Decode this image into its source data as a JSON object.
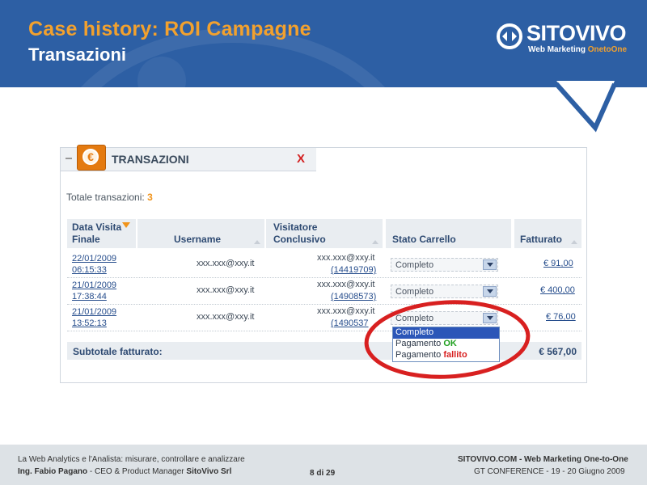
{
  "header": {
    "title": "Case history: ROI Campagne",
    "subtitle": "Transazioni",
    "logo_name": "SITOVIVO",
    "logo_tagline_main": "Web Marketing ",
    "logo_tagline_accent": "OnetoOne"
  },
  "panel": {
    "title": "TRANSAZIONI",
    "close_label": "X",
    "totals_label": "Totale transazioni: ",
    "totals_count": "3",
    "columns": {
      "date_line1": "Data Visita",
      "date_line2": "Finale",
      "username": "Username",
      "visitor_line1": "Visitatore",
      "visitor_line2": "Conclusivo",
      "status": "Stato Carrello",
      "revenue": "Fatturato"
    },
    "rows": [
      {
        "date": "22/01/2009",
        "time": "06:15:33",
        "username": "xxx.xxx@xxy.it",
        "visitor_email": "xxx.xxx@xxy.it",
        "visitor_id": "(14419709)",
        "status": "Completo",
        "revenue": "€ 91,00"
      },
      {
        "date": "21/01/2009",
        "time": "17:38:44",
        "username": "xxx.xxx@xxy.it",
        "visitor_email": "xxx.xxx@xxy.it",
        "visitor_id": "(14908573)",
        "status": "Completo",
        "revenue": "€ 400,00"
      },
      {
        "date": "21/01/2009",
        "time": "13:52:13",
        "username": "xxx.xxx@xxy.it",
        "visitor_email": "xxx.xxx@xxy.it",
        "visitor_id": "(1490537",
        "status": "Completo",
        "revenue": "€ 76,00"
      }
    ],
    "subtotal_label": "Subtotale fatturato:",
    "subtotal_value": "€ 567,00",
    "dropdown_options": {
      "complete": "Completo",
      "ok_prefix": "Pagamento ",
      "ok_word": "OK",
      "failed_prefix": "Pagamento ",
      "failed_word": "fallito"
    }
  },
  "footer": {
    "left_line1": "La Web Analytics e l'Analista: misurare, controllare e analizzare",
    "left_line2_name": "Ing. Fabio Pagano",
    "left_line2_rest": " - CEO & Product Manager ",
    "left_line2_company": "SitoVivo Srl",
    "page": "8 di 29",
    "right_line1": "SITOVIVO.COM - Web Marketing One-to-One",
    "right_line2": "GT CONFERENCE - 19 - 20 Giugno 2009"
  },
  "colors": {
    "header_blue": "#2d5fa4",
    "title_orange": "#f2a12e",
    "highlight_red": "#d82020",
    "ok_green": "#20a020"
  }
}
